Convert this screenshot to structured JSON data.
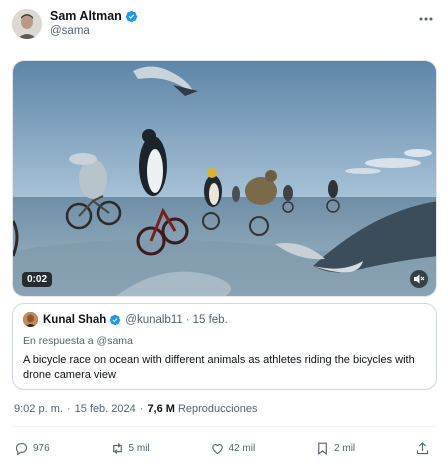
{
  "author": {
    "name": "Sam Altman",
    "handle": "@sama"
  },
  "media": {
    "duration": "0:02"
  },
  "quote": {
    "name": "Kunal Shah",
    "handle": "@kunalb11",
    "dot": "·",
    "date": "15 feb.",
    "reply_to": "En respuesta a @sama",
    "text": "A bicycle race on ocean with different animals as athletes riding the bicycles with drone camera view"
  },
  "meta": {
    "time": "9:02 p. m.",
    "dot": "·",
    "date": "15 feb. 2024",
    "views_count": "7,6 M",
    "views_label": "Reproducciones"
  },
  "actions": {
    "replies": "976",
    "reposts": "5 mil",
    "likes": "42 mil",
    "bookmarks": "2 mil"
  },
  "colors": {
    "verified": "#1d9bf0",
    "text_secondary": "#536471"
  }
}
